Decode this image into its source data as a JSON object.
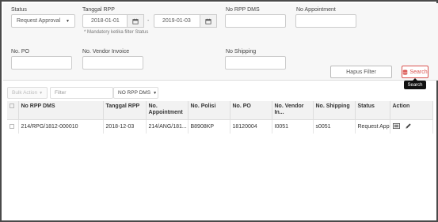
{
  "filters": {
    "status": {
      "label": "Status",
      "value": "Request Approval"
    },
    "tanggal_rpp": {
      "label": "Tanggal RPP",
      "from": "2018-01-01",
      "separator": "-",
      "to": "2019-01-03",
      "hint": "* Mandatory ketika filter Status"
    },
    "no_rpp_dms": {
      "label": "No RPP DMS",
      "value": ""
    },
    "no_appointment": {
      "label": "No Appointment",
      "value": ""
    },
    "no_po": {
      "label": "No. PO",
      "value": ""
    },
    "no_vendor_invoice": {
      "label": "No. Vendor Invoice",
      "value": ""
    },
    "no_shipping": {
      "label": "No Shipping",
      "value": ""
    },
    "hapus_filter_label": "Hapus Filter",
    "search_label": "Search",
    "search_tooltip": "Search"
  },
  "toolbar": {
    "bulk_action_label": "Bulk Action",
    "filter_placeholder": "Filter",
    "column_select_label": "NO RPP DMS"
  },
  "table": {
    "columns": [
      "No RPP DMS",
      "Tanggal RPP",
      "No. Appointment",
      "No. Polisi",
      "No. PO",
      "No. Vendor In...",
      "No. Shipping",
      "Status",
      "Action"
    ],
    "rows": [
      {
        "no_rpp_dms": "214/RPG/1812-000010",
        "tanggal_rpp": "2018-12-03",
        "no_appointment": "214/ANG/181...",
        "no_polisi": "B8908KP",
        "no_po": "18120004",
        "no_vendor_invoice": "I0051",
        "no_shipping": "s0051",
        "status": "Request Appro"
      }
    ]
  },
  "icons": {
    "calendar": "calendar-icon",
    "database": "database-icon",
    "view": "view-list-icon",
    "edit": "pencil-icon"
  },
  "colors": {
    "accent_red": "#d9534f",
    "panel_bg": "#f7f7f7",
    "header_bg": "#f2f2f2"
  }
}
